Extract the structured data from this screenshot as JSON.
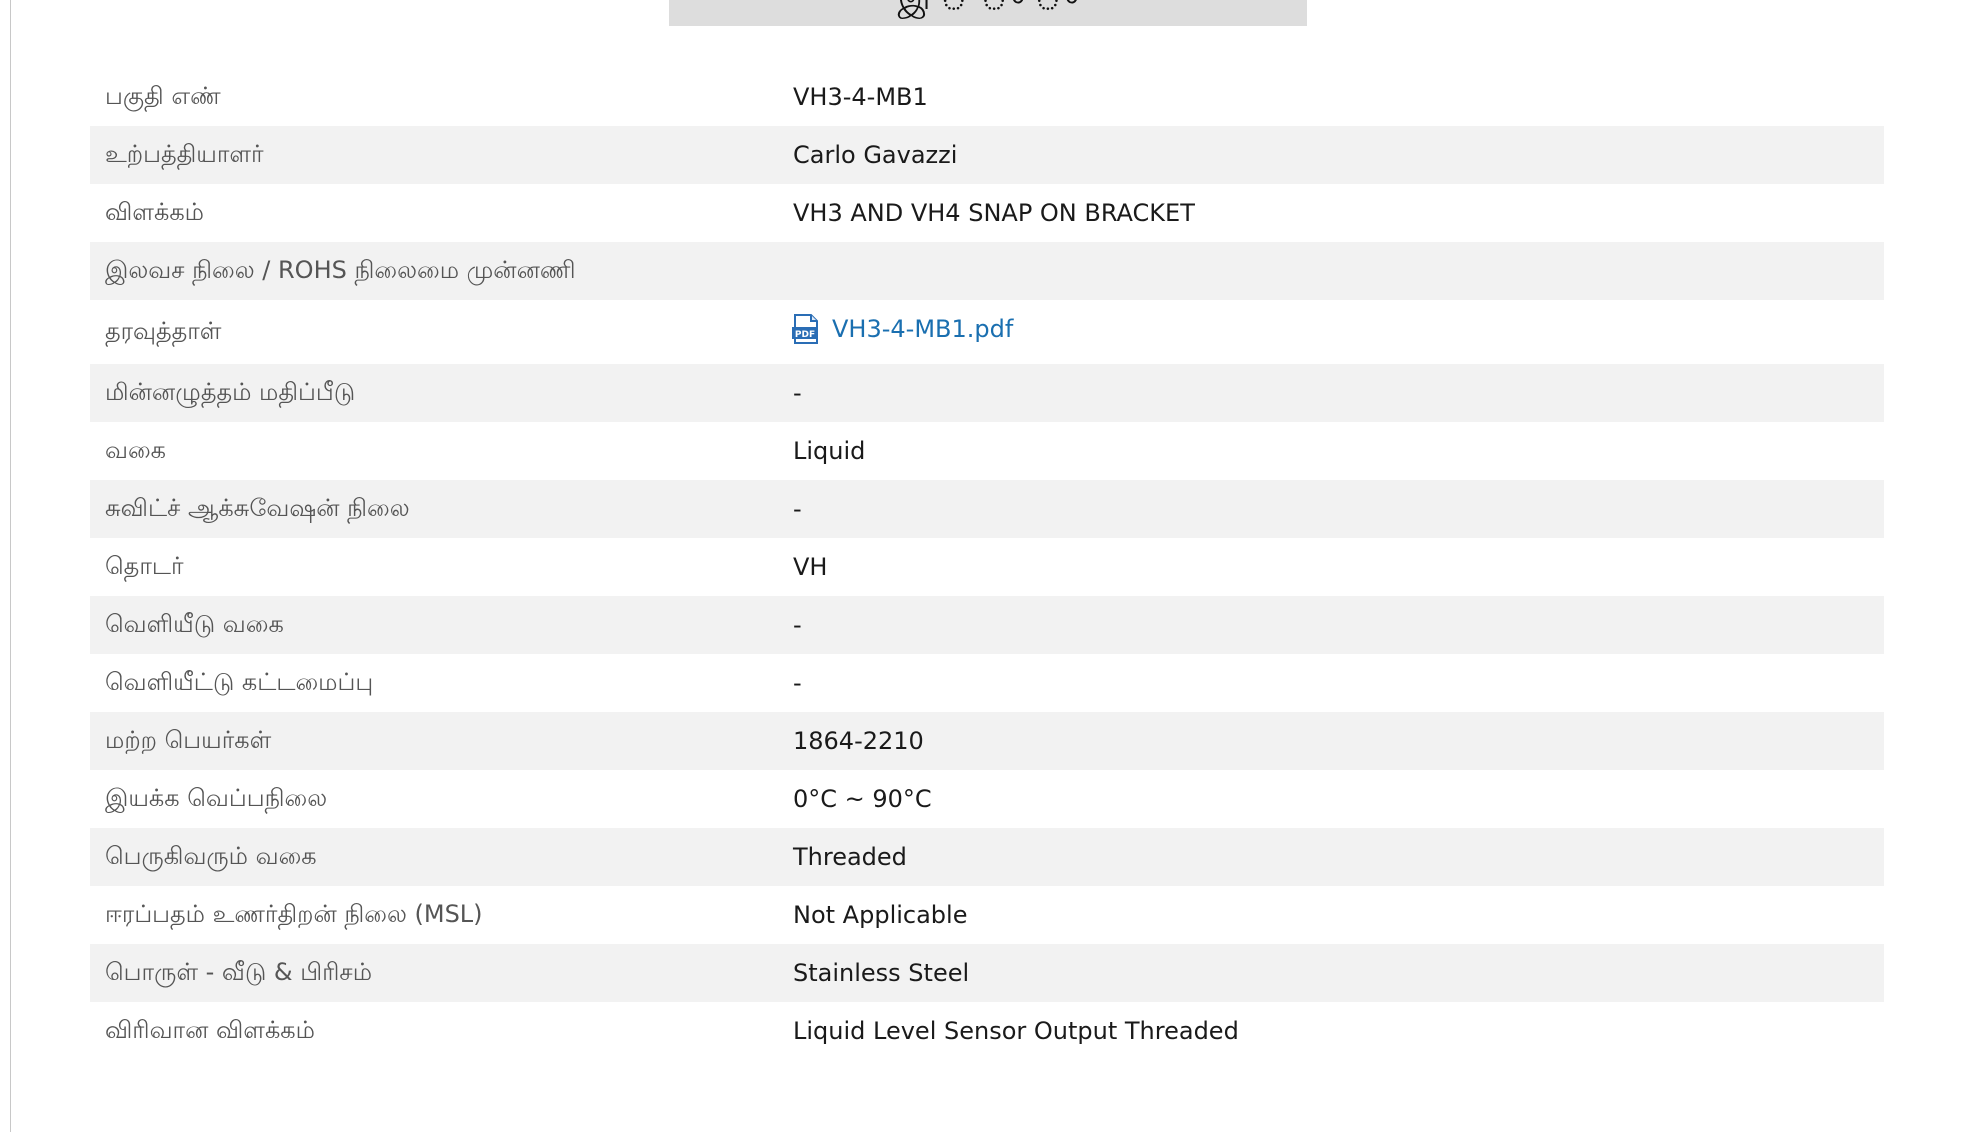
{
  "header": {
    "tab_text": "இ ் ு ு"
  },
  "specs": [
    {
      "label": "பகுதி எண்",
      "value": "VH3-4-MB1"
    },
    {
      "label": "உற்பத்தியாளர்",
      "value": "Carlo Gavazzi"
    },
    {
      "label": "விளக்கம்",
      "value": "VH3 AND VH4 SNAP ON BRACKET"
    },
    {
      "label": "இலவச நிலை / ROHS நிலைமை முன்னணி",
      "value": ""
    },
    {
      "label": "தரவுத்தாள்",
      "value": "VH3-4-MB1.pdf",
      "icon": "pdf-icon"
    },
    {
      "label": "மின்னழுத்தம் மதிப்பீடு",
      "value": "-"
    },
    {
      "label": "வகை",
      "value": "Liquid"
    },
    {
      "label": "சுவிட்ச் ஆக்சுவேஷன் நிலை",
      "value": "-"
    },
    {
      "label": "தொடர்",
      "value": "VH"
    },
    {
      "label": "வெளியீடு வகை",
      "value": "-"
    },
    {
      "label": "வெளியீட்டு கட்டமைப்பு",
      "value": "-"
    },
    {
      "label": "மற்ற பெயர்கள்",
      "value": "1864-2210"
    },
    {
      "label": "இயக்க வெப்பநிலை",
      "value": "0°C ~ 90°C"
    },
    {
      "label": "பெருகிவரும் வகை",
      "value": "Threaded"
    },
    {
      "label": "ஈரப்பதம் உணர்திறன் நிலை (MSL)",
      "value": "Not Applicable"
    },
    {
      "label": "பொருள் - வீடு & பிரிசம்",
      "value": "Stainless Steel"
    },
    {
      "label": "விரிவான விளக்கம்",
      "value": "Liquid Level Sensor Output Threaded"
    }
  ],
  "colors": {
    "link": "#1a6fb0",
    "stripe": "#f2f2f2",
    "header_tab": "#dddddd",
    "label_text": "#555555",
    "value_text": "#1a1a1a"
  }
}
